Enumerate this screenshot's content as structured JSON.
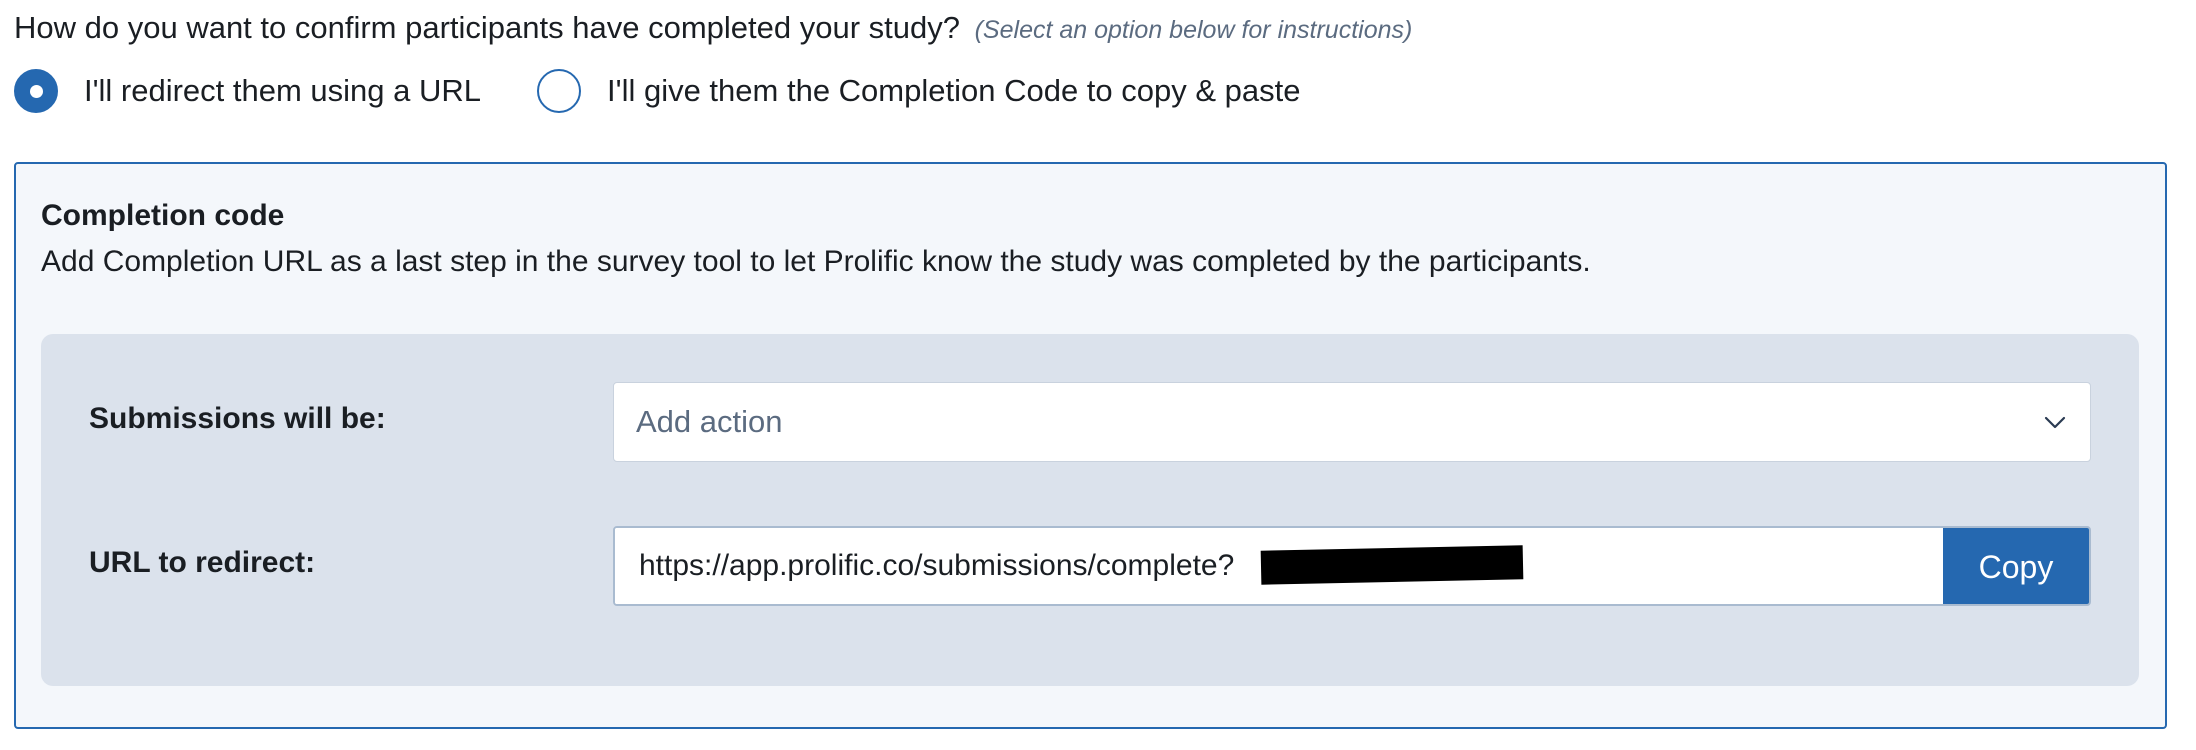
{
  "question": {
    "text": "How do you want to confirm participants have completed your study?",
    "hint": "(Select an option below for instructions)"
  },
  "options": [
    {
      "label": "I'll redirect them using a URL",
      "selected": true
    },
    {
      "label": "I'll give them the Completion Code to copy & paste",
      "selected": false
    }
  ],
  "completion": {
    "title": "Completion code",
    "description": "Add Completion URL as a last step in the survey tool to let Prolific know the study was completed by the participants.",
    "submissions_label": "Submissions will be:",
    "action_value": "Add action",
    "url_label": "URL to redirect:",
    "url_value": "https://app.prolific.co/submissions/complete?",
    "copy_label": "Copy"
  },
  "colors": {
    "accent": "#2568b0",
    "panel_bg": "#f4f7fb",
    "inner_bg": "#dbe2ec",
    "hint_text": "#5b6b80"
  },
  "icons": {
    "dropdown": "chevron-down-icon",
    "radio": "radio-button-icon"
  }
}
